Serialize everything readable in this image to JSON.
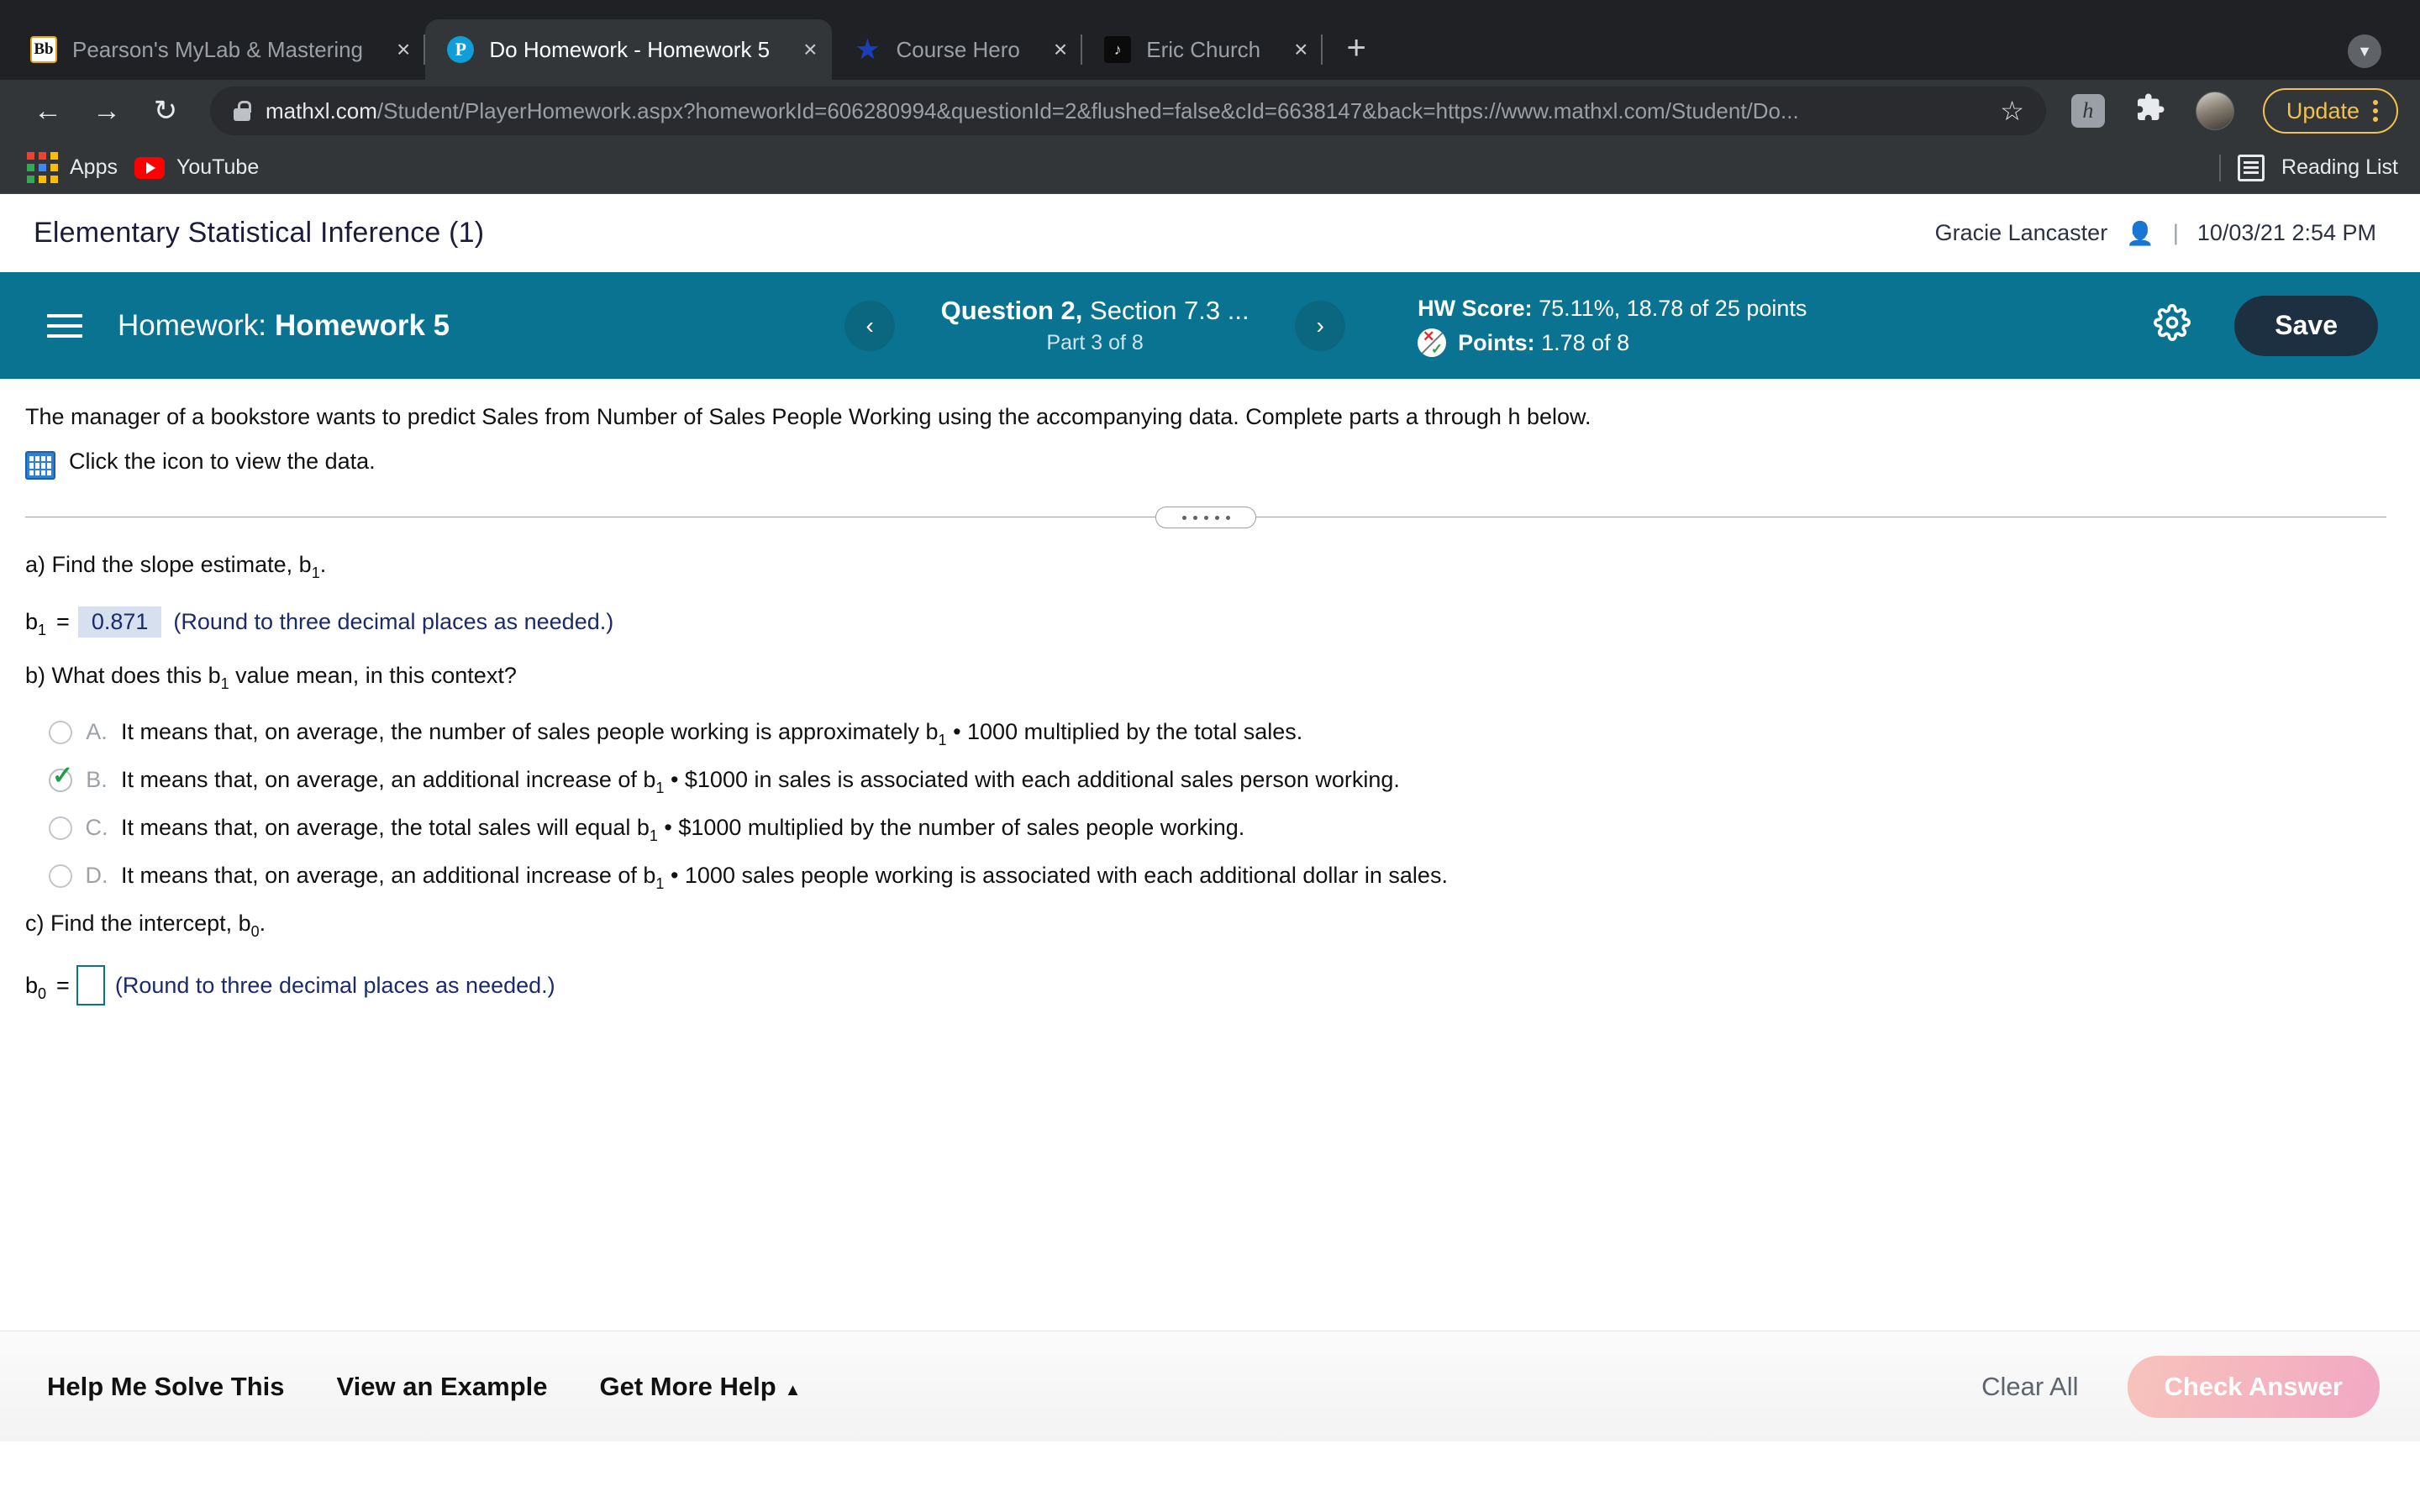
{
  "browser": {
    "tabs": [
      {
        "title": "Pearson's MyLab & Mastering",
        "favicon": "blackboard-icon",
        "favicon_glyph": "Bb",
        "active": false,
        "close_label": "×"
      },
      {
        "title": "Do Homework - Homework 5",
        "favicon": "pearson-icon",
        "favicon_glyph": "P",
        "active": true,
        "close_label": "×"
      },
      {
        "title": "Course Hero",
        "favicon": "course-hero-icon",
        "favicon_glyph": "★",
        "active": false,
        "close_label": "×"
      },
      {
        "title": "Eric Church",
        "favicon": "eric-church-icon",
        "favicon_glyph": "♪",
        "active": false,
        "close_label": "×"
      }
    ],
    "new_tab_label": "+",
    "tabstrip_overflow_label": "▼",
    "nav": {
      "back": "←",
      "forward": "→",
      "reload": "↻"
    },
    "omnibox": {
      "host": "mathxl.com",
      "path": "/Student/PlayerHomework.aspx?homeworkId=606280994&questionId=2&flushed=false&cId=6638147&back=https://www.mathxl.com/Student/Do...",
      "bookmark_star": "☆"
    },
    "extensions": {
      "honey_glyph": "h",
      "puzzle_glyph": "🧩"
    },
    "update_button": "Update",
    "bookmarks": [
      {
        "label": "Apps",
        "icon": "apps-grid-icon"
      },
      {
        "label": "YouTube",
        "icon": "youtube-icon"
      }
    ],
    "reading_list": "Reading List"
  },
  "course": {
    "title": "Elementary Statistical Inference (1)",
    "student": "Gracie Lancaster",
    "separator": "|",
    "datetime": "10/03/21 2:54 PM"
  },
  "toolbar": {
    "menu_icon": "hamburger-menu-icon",
    "homework_label": "Homework:",
    "homework_name": "Homework 5",
    "prev_label": "‹",
    "next_label": "›",
    "question_title_bold": "Question 2,",
    "question_title_rest": " Section 7.3 ...",
    "question_part": "Part 3 of 8",
    "hw_score_label": "HW Score:",
    "hw_score_value": " 75.11%, 18.78 of 25 points",
    "points_label": "Points:",
    "points_value": " 1.78 of 8",
    "settings_icon": "gear-icon",
    "save_label": "Save",
    "accent_teal": "#0a7391",
    "save_bg": "#1d3042"
  },
  "question": {
    "stem": "The manager of a bookstore wants to predict Sales from Number of Sales People Working using the accompanying data. Complete parts a through h below.",
    "data_link": "Click the icon to view the data.",
    "data_icon": "table-data-icon",
    "part_a": {
      "prompt_pre": "a) Find the slope estimate, b",
      "prompt_sub": "1",
      "prompt_post": ".",
      "answer_label_pre": "b",
      "answer_label_sub": "1",
      "equals": "=",
      "answer_value": "0.871",
      "hint": "(Round to three decimal places as needed.)"
    },
    "part_b": {
      "prompt_pre": "b) What does this b",
      "prompt_sub": "1",
      "prompt_post": " value mean, in this context?",
      "choices": [
        {
          "letter": "A.",
          "selected": false,
          "pre": "It means that, on average, the number of sales people working is approximately b",
          "sub": "1",
          "post": " • 1000 multiplied by the total sales."
        },
        {
          "letter": "B.",
          "selected": true,
          "pre": "It means that, on average, an additional increase of b",
          "sub": "1",
          "post": " • $1000 in sales is associated with each additional sales person working."
        },
        {
          "letter": "C.",
          "selected": false,
          "pre": "It means that, on average, the total sales will equal b",
          "sub": "1",
          "post": " • $1000 multiplied by the number of sales people working."
        },
        {
          "letter": "D.",
          "selected": false,
          "pre": "It means that, on average, an additional increase of b",
          "sub": "1",
          "post": " • 1000 sales people working is associated with each additional dollar in sales."
        }
      ]
    },
    "part_c": {
      "prompt_pre": "c) Find the intercept, b",
      "prompt_sub": "0",
      "prompt_post": ".",
      "answer_label_pre": "b",
      "answer_label_sub": "0",
      "equals": "=",
      "answer_value": "",
      "hint": "(Round to three decimal places as needed.)"
    }
  },
  "bottom": {
    "help_me_solve": "Help Me Solve This",
    "view_example": "View an Example",
    "get_more_help": "Get More Help",
    "get_more_help_caret": "▲",
    "clear_all": "Clear All",
    "check_answer": "Check Answer"
  }
}
